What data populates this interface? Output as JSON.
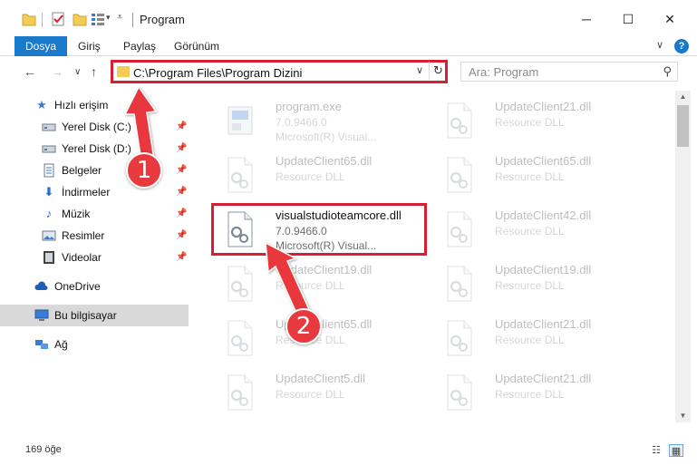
{
  "window": {
    "title": "Program",
    "minimize_glyph": "─",
    "maximize_glyph": "☐",
    "close_glyph": "✕"
  },
  "ribbon": {
    "tabs": [
      {
        "label": "Dosya",
        "active": true
      },
      {
        "label": "Giriş",
        "active": false
      },
      {
        "label": "Paylaş",
        "active": false
      },
      {
        "label": "Görünüm",
        "active": false
      }
    ],
    "help_glyph": "?"
  },
  "navigation": {
    "back_glyph": "←",
    "forward_glyph": "→",
    "recent_glyph": "∨",
    "up_glyph": "↑",
    "address": "C:\\Program Files\\Program Dizini",
    "search_placeholder": "Ara: Program"
  },
  "sidebar": {
    "items": [
      {
        "label": "Hızlı erişim",
        "icon": "star-icon",
        "pinned": false
      },
      {
        "label": "Yerel Disk (C:)",
        "icon": "drive-icon",
        "pinned": true
      },
      {
        "label": "Yerel Disk (D:)",
        "icon": "drive-icon",
        "pinned": true
      },
      {
        "label": "Belgeler",
        "icon": "documents-icon",
        "pinned": true
      },
      {
        "label": "İndirmeler",
        "icon": "download-icon",
        "pinned": true
      },
      {
        "label": "Müzik",
        "icon": "music-icon",
        "pinned": true
      },
      {
        "label": "Resimler",
        "icon": "pictures-icon",
        "pinned": true
      },
      {
        "label": "Videolar",
        "icon": "videos-icon",
        "pinned": true
      },
      {
        "label": "OneDrive",
        "icon": "cloud-icon",
        "pinned": false
      },
      {
        "label": "Bu bilgisayar",
        "icon": "computer-icon",
        "pinned": false,
        "selected": true
      },
      {
        "label": "Ağ",
        "icon": "network-icon",
        "pinned": false
      }
    ]
  },
  "files": [
    {
      "name": "program.exe",
      "line1": "7.0.9466.0",
      "line2": "Microsoft(R) Visual...",
      "icon": "exe-icon"
    },
    {
      "name": "UpdateClient21.dll",
      "line1": "Resource DLL",
      "line2": "",
      "icon": "dll-icon"
    },
    {
      "name": "UpdateClient65.dll",
      "line1": "Resource DLL",
      "line2": "",
      "icon": "dll-icon"
    },
    {
      "name": "UpdateClient65.dll",
      "line1": "Resource DLL",
      "line2": "",
      "icon": "dll-icon"
    },
    {
      "name": "visualstudioteamcore.dll",
      "line1": "7.0.9466.0",
      "line2": "Microsoft(R) Visual...",
      "icon": "dll-icon",
      "highlighted": true
    },
    {
      "name": "UpdateClient42.dll",
      "line1": "Resource DLL",
      "line2": "",
      "icon": "dll-icon"
    },
    {
      "name": "UpdateClient19.dll",
      "line1": "Resource DLL",
      "line2": "",
      "icon": "dll-icon"
    },
    {
      "name": "UpdateClient19.dll",
      "line1": "Resource DLL",
      "line2": "",
      "icon": "dll-icon"
    },
    {
      "name": "UpdateClient65.dll",
      "line1": "Resource DLL",
      "line2": "",
      "icon": "dll-icon"
    },
    {
      "name": "UpdateClient21.dll",
      "line1": "Resource DLL",
      "line2": "",
      "icon": "dll-icon"
    },
    {
      "name": "UpdateClient5.dll",
      "line1": "Resource DLL",
      "line2": "",
      "icon": "dll-icon"
    },
    {
      "name": "UpdateClient21.dll",
      "line1": "Resource DLL",
      "line2": "",
      "icon": "dll-icon"
    }
  ],
  "status": {
    "item_count": "169 öğe"
  },
  "annotations": {
    "step1": "1",
    "step2": "2",
    "color": "#e8393e"
  },
  "colors": {
    "accent": "#1979ca",
    "highlight_border": "#d61f32",
    "folder": "#f4cc55"
  }
}
